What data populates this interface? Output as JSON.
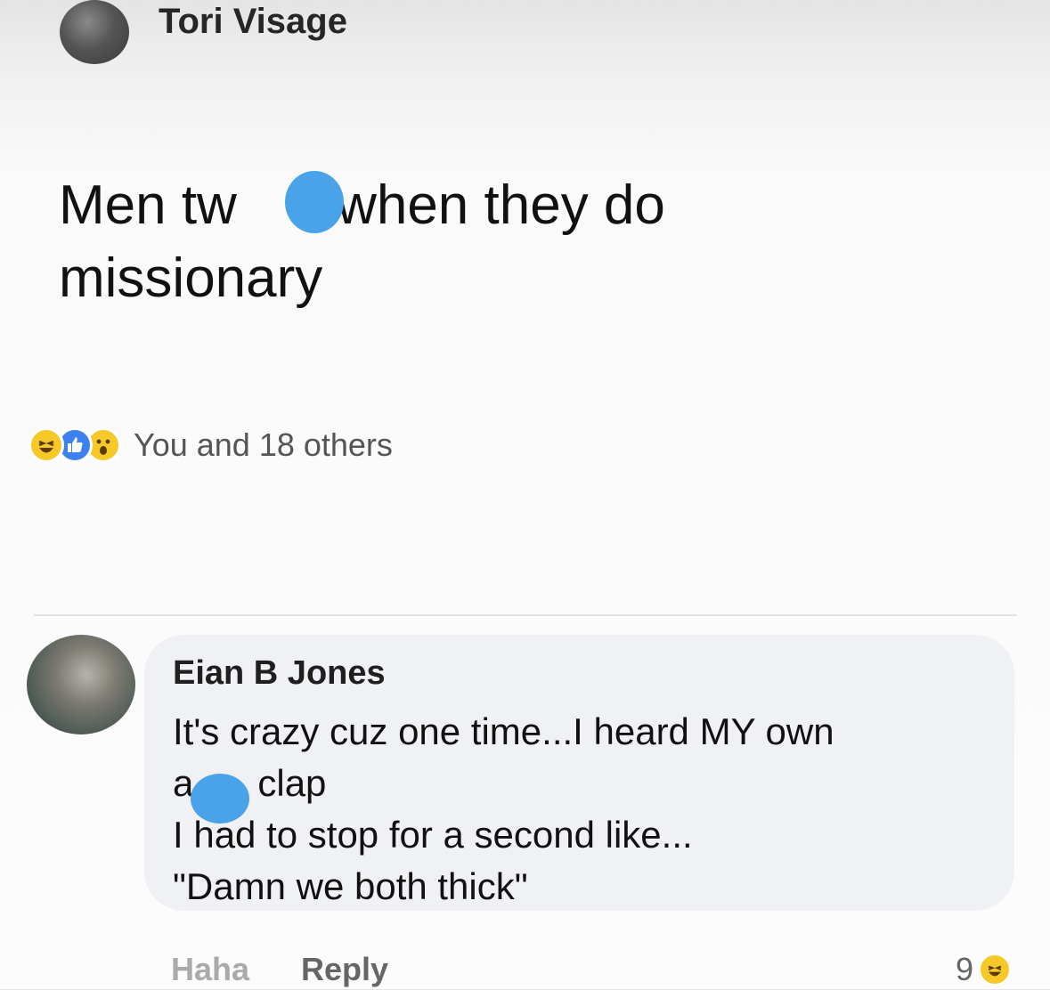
{
  "post": {
    "author": "Tori Visage",
    "text_line1_a": "Men tw",
    "text_line1_b": "k when they do",
    "text_line2": "missionary",
    "reactions": [
      "haha-icon",
      "like-icon",
      "wow-icon"
    ],
    "reaction_summary": "You and 18 others"
  },
  "comment": {
    "author": "Eian B Jones",
    "line1": "It's crazy cuz one time...I heard MY own",
    "line2_a": "a",
    "line2_b": "clap",
    "line3": "I had to stop for a second like...",
    "line4": "\"Damn we both thick\"",
    "actions": {
      "haha": "Haha",
      "reply": "Reply"
    },
    "reaction_count": "9",
    "reaction_icon": "haha-icon"
  },
  "colors": {
    "redaction": "#4aa3e8",
    "like_blue": "#3b82f0",
    "emoji_yellow": "#f7c928"
  }
}
